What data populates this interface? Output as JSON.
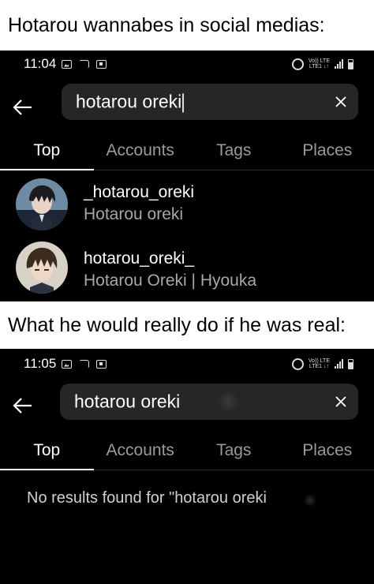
{
  "caption_top": "Hotarou wannabes in social medias:",
  "caption_mid": "What he would really do if he was real:",
  "colors": {
    "background": "#000000",
    "search_field": "#262626",
    "secondary_text": "#a8a8a8"
  },
  "screen1": {
    "status": {
      "time": "11:04",
      "network_top": "Vo)) LTE",
      "network_bottom": "LTE1 ↓↑"
    },
    "search": {
      "query": "hotarou oreki"
    },
    "tabs": [
      {
        "label": "Top",
        "active": true
      },
      {
        "label": "Accounts",
        "active": false
      },
      {
        "label": "Tags",
        "active": false
      },
      {
        "label": "Places",
        "active": false
      }
    ],
    "results": [
      {
        "username": "_hotarou_oreki",
        "fullname": "Hotarou oreki"
      },
      {
        "username": "hotarou_oreki_",
        "fullname": "Hotarou Oreki | Hyouka"
      }
    ]
  },
  "screen2": {
    "status": {
      "time": "11:05",
      "network_top": "Vo)) LTE",
      "network_bottom": "LTE1 ↓↑"
    },
    "search": {
      "query": "hotarou oreki"
    },
    "tabs": [
      {
        "label": "Top",
        "active": true
      },
      {
        "label": "Accounts",
        "active": false
      },
      {
        "label": "Tags",
        "active": false
      },
      {
        "label": "Places",
        "active": false
      }
    ],
    "no_results": "No results found for \"hotarou oreki"
  }
}
